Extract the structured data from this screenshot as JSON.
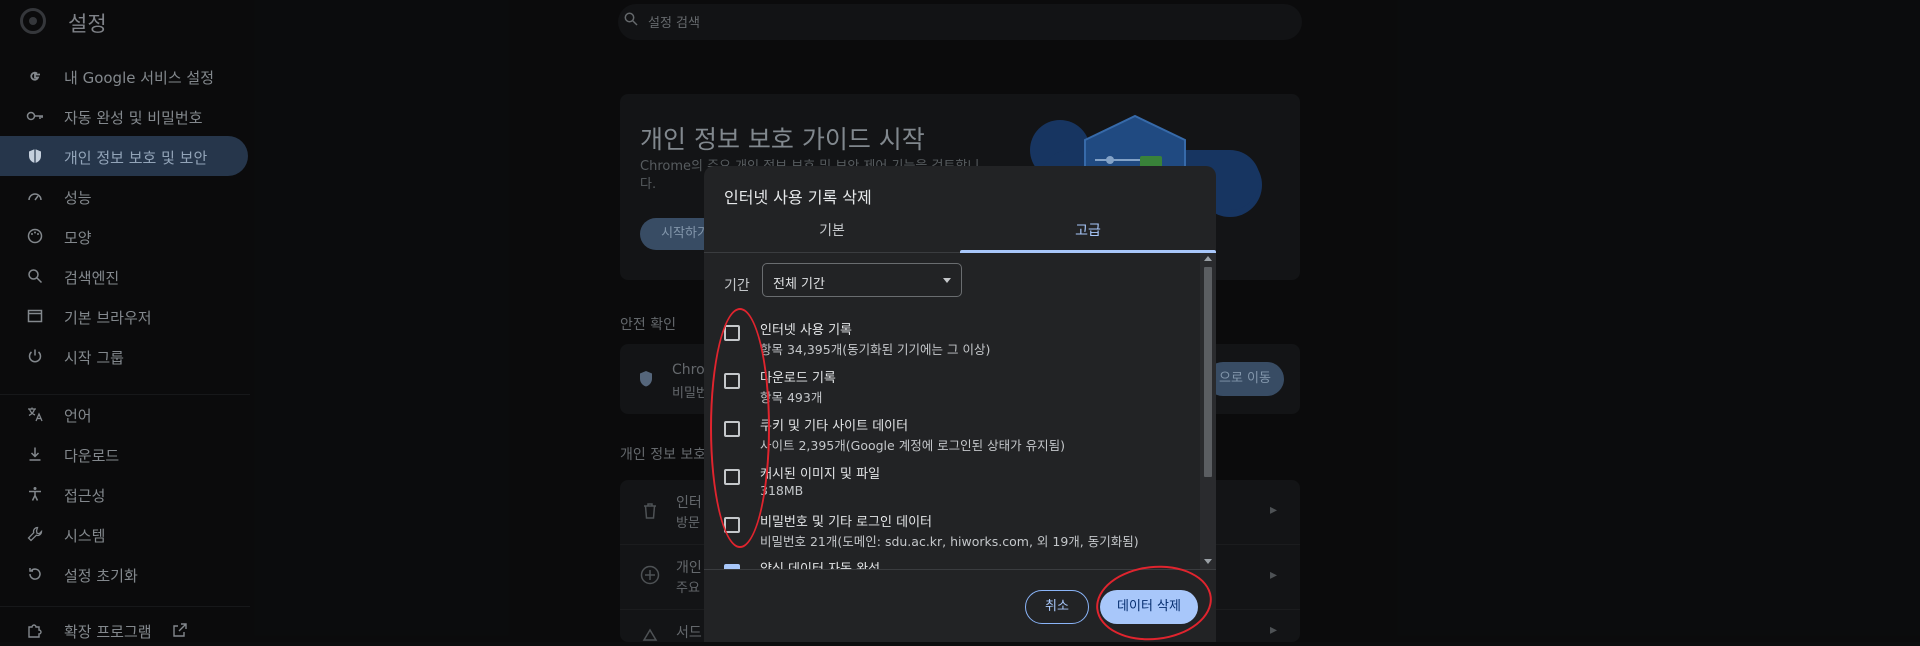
{
  "header": {
    "title": "설정",
    "search_placeholder": "설정 검색"
  },
  "sidebar": {
    "items": [
      {
        "icon": "google-icon",
        "label": "내 Google 서비스 설정"
      },
      {
        "icon": "key-icon",
        "label": "자동 완성 및 비밀번호"
      },
      {
        "icon": "shield-icon",
        "label": "개인 정보 보호 및 보안",
        "active": true
      },
      {
        "icon": "speedometer-icon",
        "label": "성능"
      },
      {
        "icon": "palette-icon",
        "label": "모양"
      },
      {
        "icon": "search-icon",
        "label": "검색엔진"
      },
      {
        "icon": "browser-window-icon",
        "label": "기본 브라우저"
      },
      {
        "icon": "power-icon",
        "label": "시작 그룹"
      },
      {
        "icon": "translate-icon",
        "label": "언어"
      },
      {
        "icon": "download-icon",
        "label": "다운로드"
      },
      {
        "icon": "accessibility-icon",
        "label": "접근성"
      },
      {
        "icon": "wrench-icon",
        "label": "시스템"
      },
      {
        "icon": "reset-icon",
        "label": "설정 초기화"
      },
      {
        "icon": "puzzle-icon",
        "label": "확장 프로그램"
      }
    ]
  },
  "main": {
    "guide_title": "개인 정보 보호 가이드 시작",
    "guide_desc": "Chrome의 주요 개인 정보 보호 및 보안 제어 기능을 검토합니다.",
    "guide_button": "시작하기",
    "safety_label": "안전 확인",
    "safety_item_title": "Chrome",
    "safety_item_sub": "비밀번",
    "safety_button": "으로 이동",
    "privacy_label": "개인 정보 보호",
    "privacy_rows": [
      {
        "title": "인터",
        "sub": "방문"
      },
      {
        "title": "개인",
        "sub": "주요"
      },
      {
        "title": "서드",
        "sub": ""
      }
    ]
  },
  "dialog": {
    "title": "인터넷 사용 기록 삭제",
    "tabs": [
      "기본",
      "고급"
    ],
    "active_tab": 1,
    "time_range_label": "기간",
    "time_range_value": "전체 기간",
    "options": [
      {
        "title": "인터넷 사용 기록",
        "desc": "항목 34,395개(동기화된 기기에는 그 이상)",
        "checked": false
      },
      {
        "title": "다운로드 기록",
        "desc": "항목 493개",
        "checked": false
      },
      {
        "title": "쿠키 및 기타 사이트 데이터",
        "desc": "사이트 2,395개(Google 계정에 로그인된 상태가 유지됨)",
        "checked": false
      },
      {
        "title": "캐시된 이미지 및 파일",
        "desc": "318MB",
        "checked": false
      },
      {
        "title": "비밀번호 및 기타 로그인 데이터",
        "desc": "비밀번호 21개(도메인: sdu.ac.kr, hiworks.com, 외 19개, 동기화됨)",
        "checked": false
      },
      {
        "title": "양식 데이터 자동 완성",
        "desc": "",
        "checked": true
      }
    ],
    "cancel_label": "취소",
    "delete_label": "데이터 삭제"
  },
  "colors": {
    "accent": "#a8c7fa",
    "annotation": "#e0242e",
    "dialog_bg": "#222325"
  }
}
